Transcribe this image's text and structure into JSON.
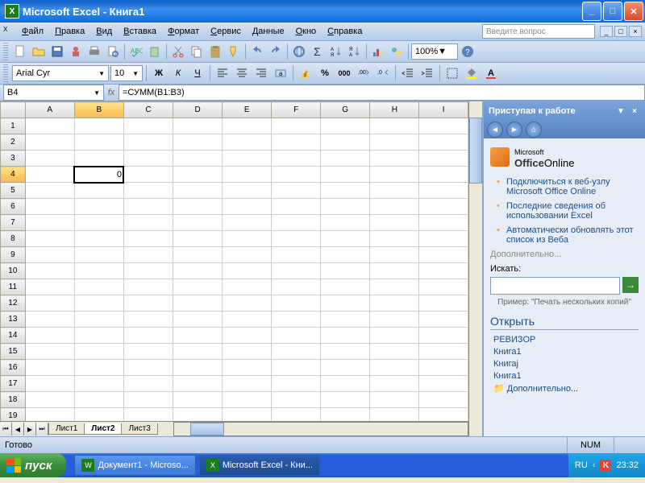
{
  "window": {
    "app": "Microsoft Excel",
    "doc": "Книга1"
  },
  "menu": [
    "Файл",
    "Правка",
    "Вид",
    "Вставка",
    "Формат",
    "Сервис",
    "Данные",
    "Окно",
    "Справка"
  ],
  "help_placeholder": "Введите вопрос",
  "zoom": "100%",
  "font": {
    "name": "Arial Cyr",
    "size": "10"
  },
  "namebox": "B4",
  "formula": "=СУММ(B1:B3)",
  "active_cell": {
    "row": 4,
    "col": "B",
    "value": "0"
  },
  "columns": [
    "A",
    "B",
    "C",
    "D",
    "E",
    "F",
    "G",
    "H",
    "I"
  ],
  "rows": 23,
  "sheet_tabs": [
    "Лист1",
    "Лист2",
    "Лист3"
  ],
  "active_sheet": 1,
  "task_pane": {
    "title": "Приступая к работе",
    "brand_a": "Microsoft",
    "brand_b": "Office",
    "brand_c": "Online",
    "links": [
      "Подключиться к веб-узлу Microsoft Office Online",
      "Последние сведения об использовании Excel",
      "Автоматически обновлять этот список из Веба"
    ],
    "more": "Дополнительно...",
    "search_label": "Искать:",
    "example": "Пример: \"Печать нескольких копий\"",
    "open_hdr": "Открыть",
    "recent": [
      "РЕВИЗОР",
      "Книга1",
      "Книгај",
      "Книга1"
    ],
    "more2": "Дополнительно..."
  },
  "status": {
    "ready": "Готово",
    "num": "NUM"
  },
  "taskbar": {
    "start": "пуск",
    "items": [
      "Документ1 - Microso...",
      "Microsoft Excel - Кни..."
    ],
    "lang": "RU",
    "time": "23:32"
  }
}
